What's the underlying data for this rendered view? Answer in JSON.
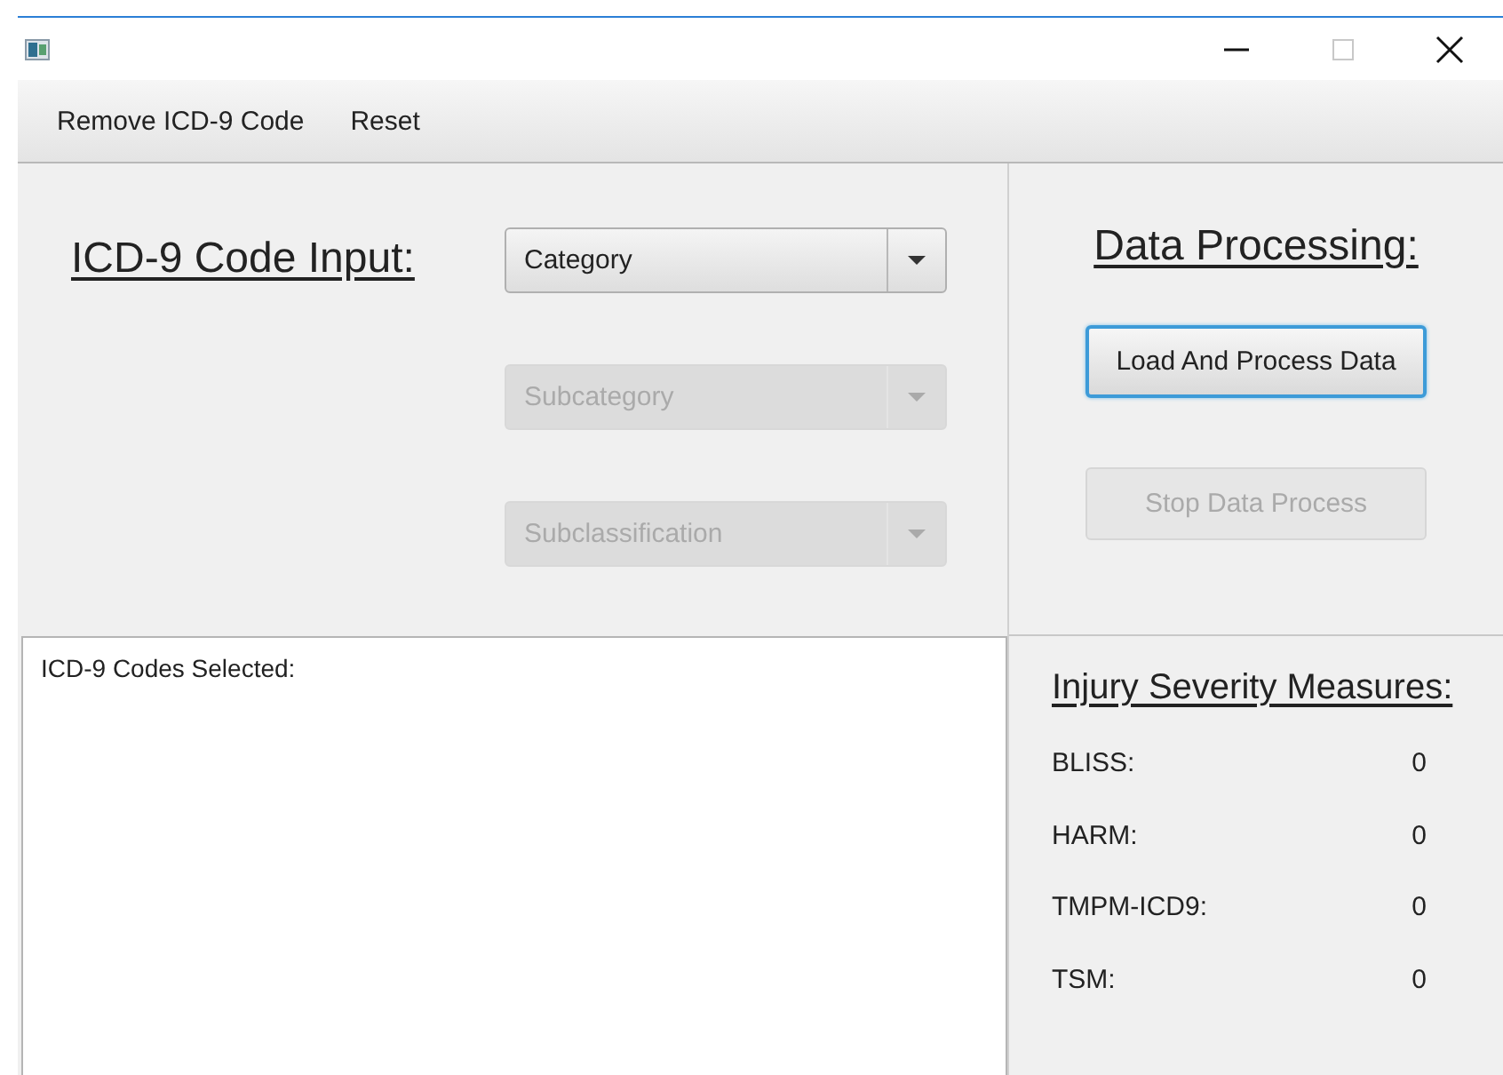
{
  "window": {
    "controls": [
      {
        "kind": "minimize",
        "disabled": false
      },
      {
        "kind": "maximize",
        "disabled": true
      },
      {
        "kind": "close",
        "disabled": false
      }
    ]
  },
  "menu": [
    {
      "label": "Remove ICD-9 Code"
    },
    {
      "label": "Reset"
    }
  ],
  "code_input": {
    "heading": "ICD-9 Code Input:",
    "combos": [
      {
        "text": "Category",
        "disabled": false
      },
      {
        "text": "Subcategory",
        "disabled": true
      },
      {
        "text": "Subclassification",
        "disabled": true
      }
    ]
  },
  "selected_codes": {
    "label": "ICD-9 Codes Selected:"
  },
  "data_processing": {
    "heading": "Data Processing:",
    "buttons": [
      {
        "label": "Load And Process Data",
        "disabled": false,
        "focused": true
      },
      {
        "label": "Stop Data Process",
        "disabled": true,
        "focused": false
      }
    ]
  },
  "measures": {
    "heading": "Injury Severity Measures:",
    "items": [
      {
        "name": "BLISS:",
        "value": "0"
      },
      {
        "name": "HARM:",
        "value": "0"
      },
      {
        "name": "TMPM-ICD9:",
        "value": "0"
      },
      {
        "name": "TSM:",
        "value": "0"
      }
    ]
  }
}
